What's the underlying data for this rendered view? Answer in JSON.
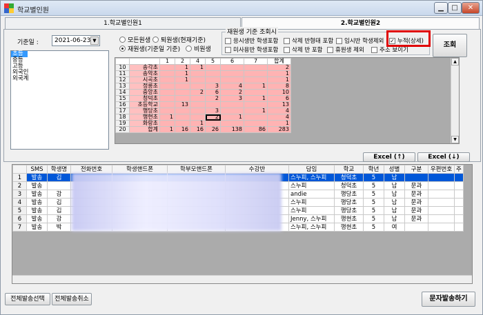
{
  "window": {
    "title": "학교별인원",
    "min": "▁",
    "max": "□",
    "close": "✕"
  },
  "tabs": [
    {
      "label": "1.학교별인원1"
    },
    {
      "label": "2.학교별인원2"
    }
  ],
  "filter": {
    "date_label": "기준일 :",
    "date_value": "2021-06-23",
    "radios": [
      {
        "label": "모든원생",
        "checked": false
      },
      {
        "label": "퇴원생(현재기준)",
        "checked": false
      },
      {
        "label": "재원생(기준일 기준)",
        "checked": true
      },
      {
        "label": "비원생",
        "checked": false
      }
    ],
    "school_levels": [
      "초등",
      "중등",
      "고등",
      "외국인",
      "외국계"
    ],
    "group_title": "재원생 기준 조회시",
    "checks": [
      {
        "label": "응시생반 학생포함",
        "checked": false
      },
      {
        "label": "삭제 반형태 포함",
        "checked": false
      },
      {
        "label": "임시반 학생제외",
        "checked": false
      },
      {
        "label": "누적(상세)",
        "checked": true
      },
      {
        "label": "미사용반 학생포함",
        "checked": false
      },
      {
        "label": "삭제 반 포함",
        "checked": false
      },
      {
        "label": "휴원생 제외",
        "checked": false
      },
      {
        "label": "주소 보이기",
        "checked": false
      }
    ],
    "search_button": "조회"
  },
  "top_grid": {
    "columns": [
      "",
      "",
      "1",
      "2",
      "4",
      "5",
      "6",
      "7",
      "합계"
    ],
    "rows": [
      [
        "10",
        "송각초",
        "",
        "1",
        "1",
        "",
        "",
        "",
        "2"
      ],
      [
        "11",
        "송악초",
        "",
        "1",
        "",
        "",
        "",
        "",
        "1"
      ],
      [
        "12",
        "시곡초",
        "",
        "1",
        "",
        "",
        "",
        "",
        "1"
      ],
      [
        "13",
        "정릉초",
        "",
        "",
        "",
        "3",
        "4",
        "1",
        "8"
      ],
      [
        "14",
        "중앙초",
        "",
        "",
        "2",
        "6",
        "2",
        "",
        "10"
      ],
      [
        "15",
        "청덕초",
        "",
        "",
        "",
        "2",
        "3",
        "1",
        "6"
      ],
      [
        "16",
        "초등학교",
        "",
        "13",
        "",
        "",
        "",
        "",
        "13"
      ],
      [
        "17",
        "행당초",
        "",
        "",
        "",
        "3",
        "",
        "1",
        "4"
      ],
      [
        "18",
        "행현초",
        "1",
        "",
        "",
        "2",
        "1",
        "",
        "4"
      ],
      [
        "19",
        "화랑초",
        "",
        "",
        "1",
        "",
        "",
        "",
        "1"
      ],
      [
        "20",
        "합계",
        "1",
        "16",
        "16",
        "26",
        "138",
        "86",
        "283"
      ]
    ]
  },
  "excel_up": "Excel (↑)",
  "excel_down": "Excel (↓)",
  "bottom_grid": {
    "columns": [
      "",
      "SMS",
      "학생명",
      "전화번호",
      "학생핸드폰",
      "학부모핸드폰",
      "수강반",
      "담임",
      "학교",
      "학년",
      "성별",
      "구분",
      "우편번호",
      "주"
    ],
    "rows": [
      [
        "1",
        "발송",
        "김",
        "",
        "",
        "",
        "",
        "스누피, 스누피",
        "청덕초",
        "5",
        "남",
        "",
        "",
        ""
      ],
      [
        "2",
        "발송",
        "",
        "",
        "",
        "",
        "",
        "스누피",
        "청덕초",
        "5",
        "남",
        "문과",
        "",
        ""
      ],
      [
        "3",
        "발송",
        "강",
        "",
        "",
        "",
        "",
        "andie",
        "행당초",
        "5",
        "남",
        "문과",
        "",
        ""
      ],
      [
        "4",
        "발송",
        "김",
        "",
        "",
        "",
        "",
        "스누피",
        "행당초",
        "5",
        "남",
        "문과",
        "",
        ""
      ],
      [
        "5",
        "발송",
        "김",
        "",
        "",
        "",
        "",
        "스누피",
        "행당초",
        "5",
        "남",
        "문과",
        "",
        ""
      ],
      [
        "6",
        "발송",
        "강",
        "",
        "",
        "",
        "",
        "Jenny, 스누피",
        "행현초",
        "5",
        "남",
        "문과",
        "",
        ""
      ],
      [
        "7",
        "발송",
        "박",
        "",
        "",
        "",
        "",
        "스누피, 스누피",
        "행현초",
        "5",
        "여",
        "",
        "",
        ""
      ]
    ]
  },
  "footer": {
    "send_all": "전체발송선택",
    "cancel_all": "전체발송취소",
    "send_sms": "문자발송하기"
  }
}
